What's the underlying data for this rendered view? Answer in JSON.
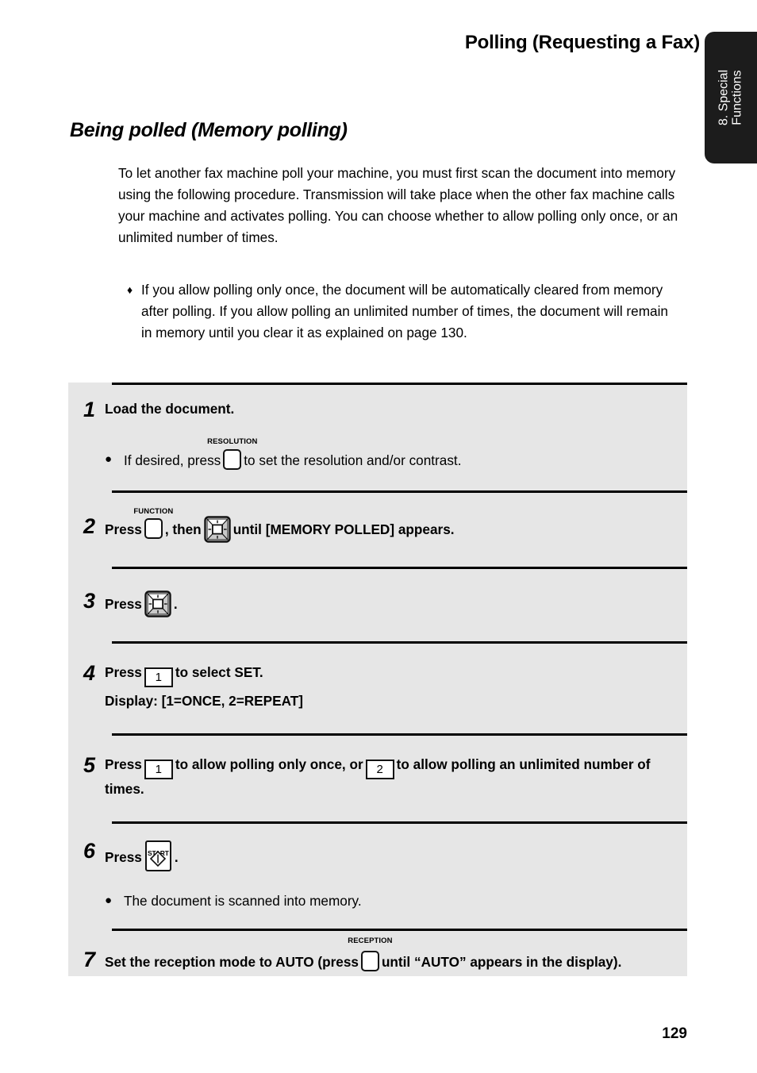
{
  "header": {
    "title": "Polling (Requesting a Fax)"
  },
  "side_tab": {
    "line1": "8. Special",
    "line2": "Functions"
  },
  "section": {
    "heading": "Being polled (Memory polling)",
    "intro": "To let another fax machine poll your machine, you must first scan the document into memory using the following procedure. Transmission will take place when the other fax machine calls your machine and activates polling. You can choose whether to allow polling only once, or an unlimited number of times.",
    "note_marker": "♦",
    "note": "If you allow polling only once, the document will be automatically cleared from memory after polling. If you allow polling an unlimited number of times, the document will remain in memory until you clear it as explained on page 130."
  },
  "steps": [
    {
      "number": "1",
      "title": "Load the document.",
      "bullet_marker": "●",
      "sub_pre": "If desired, press",
      "key_label": "RESOLUTION",
      "sub_post": "to set the resolution and/or contrast."
    },
    {
      "number": "2",
      "text_1": "Press",
      "key_label": "FUNCTION",
      "text_2": ", then",
      "nav_key": "nav-key-icon",
      "text_3": "until [MEMORY POLLED] appears."
    },
    {
      "number": "3",
      "text_1": "Press",
      "nav_key": "nav-key-icon",
      "text_2": "."
    },
    {
      "number": "4",
      "text_1": "Press",
      "num_key": "1",
      "text_2": "to select SET.",
      "line2": "Display: [1=ONCE, 2=REPEAT]"
    },
    {
      "number": "5",
      "text_1": "Press",
      "num_key_1": "1",
      "text_2": "to allow polling only once, or",
      "num_key_2": "2",
      "text_3": "to allow polling an unlimited number of times."
    },
    {
      "number": "6",
      "text_1": "Press",
      "start_key": "START",
      "text_2": ".",
      "bullet_marker": "●",
      "sub": "The document is scanned into memory."
    },
    {
      "number": "7",
      "text_1": "Set the reception mode to AUTO (press",
      "key_label": "RECEPTION",
      "text_2": "until “AUTO” appears in the display)."
    }
  ],
  "footer": {
    "page_number": "129"
  },
  "colors": {
    "panel_bg": "#e6e6e6",
    "tab_bg": "#1c1c1c",
    "rule": "#000000"
  }
}
